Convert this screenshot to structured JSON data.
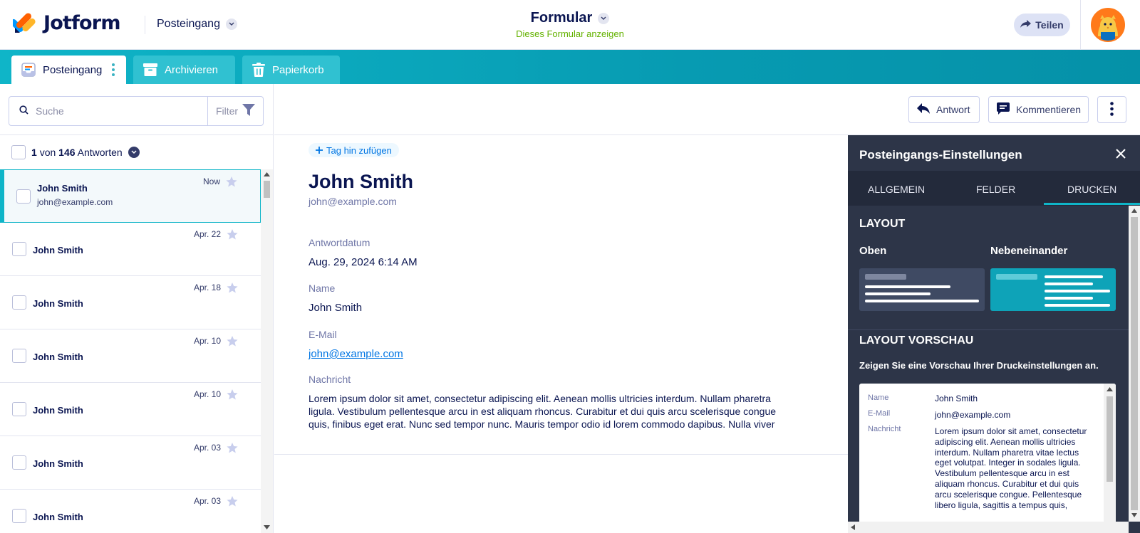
{
  "header": {
    "logo_text": "Jotform",
    "inbox_label": "Posteingang",
    "form_title": "Formular",
    "form_view_link": "Dieses Formular anzeigen",
    "share_label": "Teilen"
  },
  "tabs": [
    {
      "label": "Posteingang",
      "icon": "inbox-icon"
    },
    {
      "label": "Archivieren",
      "icon": "archive-icon"
    },
    {
      "label": "Papierkorb",
      "icon": "trash-icon"
    }
  ],
  "list": {
    "search_placeholder": "Suche",
    "filter_label": "Filter",
    "count_current": "1",
    "count_sep": "von",
    "count_total": "146",
    "count_suffix": "Antworten",
    "items": [
      {
        "name": "John Smith",
        "email": "john@example.com",
        "date": "Now"
      },
      {
        "name": "John Smith",
        "date": "Apr. 22"
      },
      {
        "name": "John Smith",
        "date": "Apr. 18"
      },
      {
        "name": "John Smith",
        "date": "Apr. 10"
      },
      {
        "name": "John Smith",
        "date": "Apr. 10"
      },
      {
        "name": "John Smith",
        "date": "Apr. 03"
      },
      {
        "name": "John Smith",
        "date": "Apr. 03"
      }
    ]
  },
  "toolbar": {
    "reply_label": "Antwort",
    "comment_label": "Kommentieren"
  },
  "detail": {
    "tag_label": "Tag hin zufügen",
    "name": "John Smith",
    "email": "john@example.com",
    "fields": {
      "date_label": "Antwortdatum",
      "date_value": "Aug. 29, 2024 6:14 AM",
      "name_label": "Name",
      "name_value": "John Smith",
      "email_label": "E-Mail",
      "email_value": "john@example.com",
      "message_label": "Nachricht",
      "message_lines": [
        "Lorem ipsum dolor sit amet, consectetur adipiscing elit. Aenean mollis ultricies interdum. Nullam pharetra",
        "ligula. Vestibulum pellentesque arcu in est aliquam rhoncus. Curabitur et dui quis arcu scelerisque congue",
        "quis, finibus eget erat. Nunc sed tempor nunc. Mauris tempor odio id lorem commodo dapibus. Nulla viver"
      ]
    }
  },
  "panel": {
    "title": "Posteingangs-Einstellungen",
    "tabs": [
      "ALLGEMEIN",
      "FELDER",
      "DRUCKEN"
    ],
    "active_tab": "DRUCKEN",
    "layout_title": "LAYOUT",
    "layout_options": [
      "Oben",
      "Nebeneinander"
    ],
    "preview_title": "LAYOUT VORSCHAU",
    "preview_sub": "Zeigen Sie eine Vorschau Ihrer Druckeinstellungen an.",
    "preview": {
      "name_label": "Name",
      "name_value": "John Smith",
      "email_label": "E-Mail",
      "email_value": "john@example.com",
      "message_label": "Nachricht",
      "message_value": "Lorem ipsum dolor sit amet, consectetur adipiscing elit. Aenean mollis ultricies interdum. Nullam pharetra vitae lectus eget volutpat. Integer in sodales ligula. Vestibulum pellentesque arcu in est aliquam rhoncus. Curabitur et dui quis arcu scelerisque congue. Pellentesque libero ligula, sagittis a tempus quis,"
    }
  },
  "colors": {
    "accent": "#0fb5c8",
    "navy": "#0a1551",
    "panel_bg": "#2d3548",
    "link_green": "#64b200"
  }
}
